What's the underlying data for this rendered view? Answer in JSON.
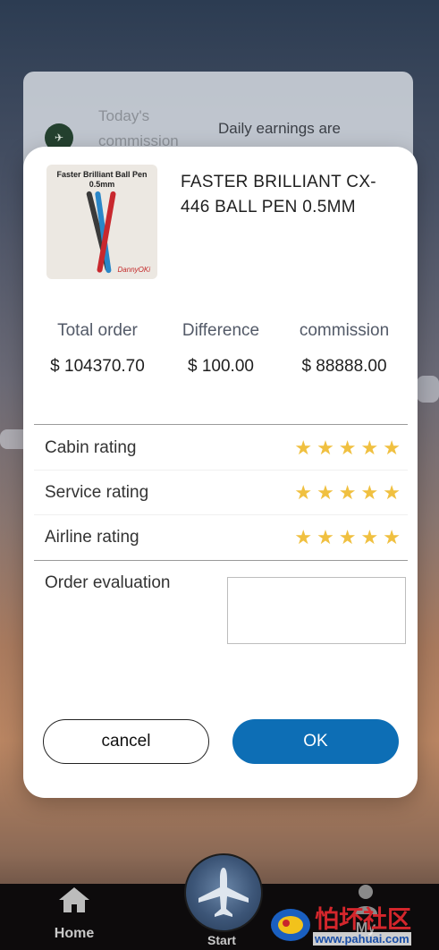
{
  "under_card": {
    "icon": "airline-logo-icon",
    "label": "Today's commission",
    "text": "Daily earnings are automatically updated"
  },
  "modal": {
    "product_image_caption": "Faster Brilliant Ball Pen 0.5mm",
    "product_image_signature": "DannyOKi",
    "product_title": "FASTER BRILLIANT CX-446 BALL PEN 0.5MM",
    "stats": [
      {
        "label": "Total order",
        "value": "$ 104370.70"
      },
      {
        "label": "Difference",
        "value": "$ 100.00"
      },
      {
        "label": "commission",
        "value": "$ 88888.00"
      }
    ],
    "ratings": [
      {
        "label": "Cabin rating",
        "stars": 5
      },
      {
        "label": "Service rating",
        "stars": 5
      },
      {
        "label": "Airline rating",
        "stars": 5
      }
    ],
    "evaluation_label": "Order evaluation",
    "evaluation_value": "",
    "cancel_label": "cancel",
    "ok_label": "OK"
  },
  "nav": {
    "home_label": "Home",
    "start_label": "Start",
    "my_label": "My"
  },
  "watermark": {
    "text_cn": "怕坏社区",
    "url": "www.pahuai.com"
  },
  "colors": {
    "accent": "#0d6eb5",
    "star": "#f0c040"
  }
}
